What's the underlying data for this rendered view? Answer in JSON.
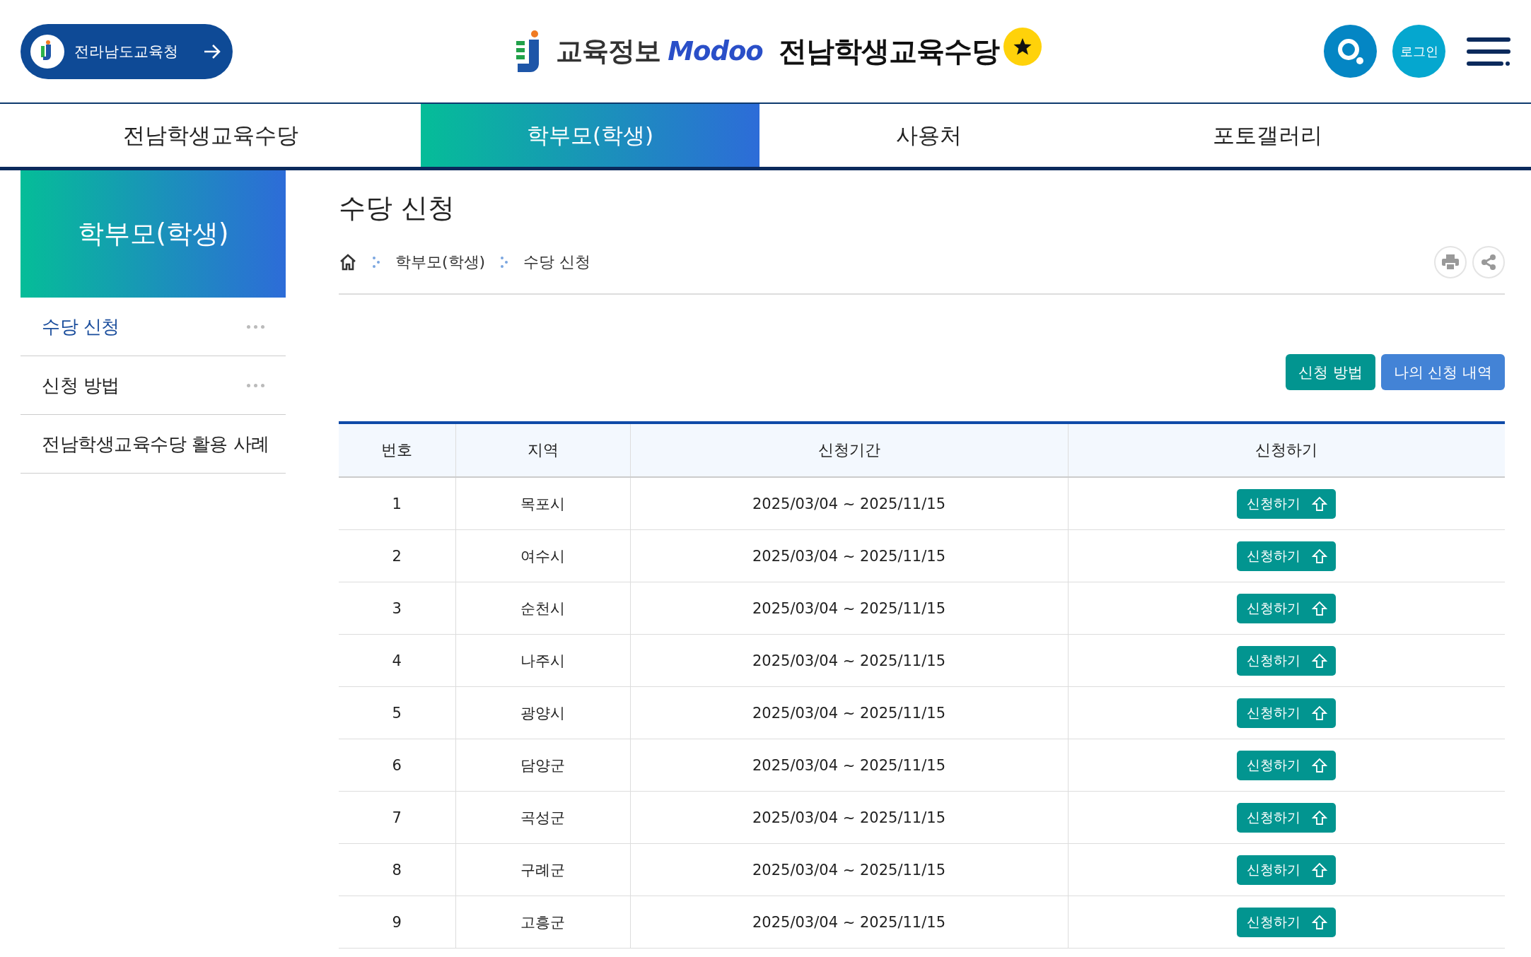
{
  "header": {
    "org_link": "전라남도교육청",
    "logo_text": "교육정보",
    "logo_brand": "Modoo",
    "site_title": "전남학생교육수당",
    "login": "로그인"
  },
  "nav": [
    {
      "label": "전남학생교육수당",
      "selected": false
    },
    {
      "label": "학부모(학생)",
      "selected": true
    },
    {
      "label": "사용처",
      "selected": false
    },
    {
      "label": "포토갤러리",
      "selected": false
    }
  ],
  "sidebar": {
    "title": "학부모(학생)",
    "items": [
      {
        "label": "수당 신청",
        "selected": true,
        "expandable": true
      },
      {
        "label": "신청 방법",
        "selected": false,
        "expandable": true
      },
      {
        "label": "전남학생교육수당 활용 사례",
        "selected": false,
        "expandable": false
      }
    ]
  },
  "page": {
    "title": "수당 신청",
    "breadcrumb": [
      "학부모(학생)",
      "수당 신청"
    ],
    "buttons": [
      {
        "label": "신청 방법",
        "kind": "primary"
      },
      {
        "label": "나의 신청 내역",
        "kind": "secondary"
      }
    ]
  },
  "table": {
    "columns": [
      "번호",
      "지역",
      "신청기간",
      "신청하기"
    ],
    "rows": [
      {
        "no": "1",
        "region": "목포시",
        "period": "2025/03/04 ~ 2025/11/15",
        "action": "신청하기"
      },
      {
        "no": "2",
        "region": "여수시",
        "period": "2025/03/04 ~ 2025/11/15",
        "action": "신청하기"
      },
      {
        "no": "3",
        "region": "순천시",
        "period": "2025/03/04 ~ 2025/11/15",
        "action": "신청하기"
      },
      {
        "no": "4",
        "region": "나주시",
        "period": "2025/03/04 ~ 2025/11/15",
        "action": "신청하기"
      },
      {
        "no": "5",
        "region": "광양시",
        "period": "2025/03/04 ~ 2025/11/15",
        "action": "신청하기"
      },
      {
        "no": "6",
        "region": "담양군",
        "period": "2025/03/04 ~ 2025/11/15",
        "action": "신청하기"
      },
      {
        "no": "7",
        "region": "곡성군",
        "period": "2025/03/04 ~ 2025/11/15",
        "action": "신청하기"
      },
      {
        "no": "8",
        "region": "구례군",
        "period": "2025/03/04 ~ 2025/11/15",
        "action": "신청하기"
      },
      {
        "no": "9",
        "region": "고흥군",
        "period": "2025/03/04 ~ 2025/11/15",
        "action": "신청하기"
      }
    ]
  }
}
